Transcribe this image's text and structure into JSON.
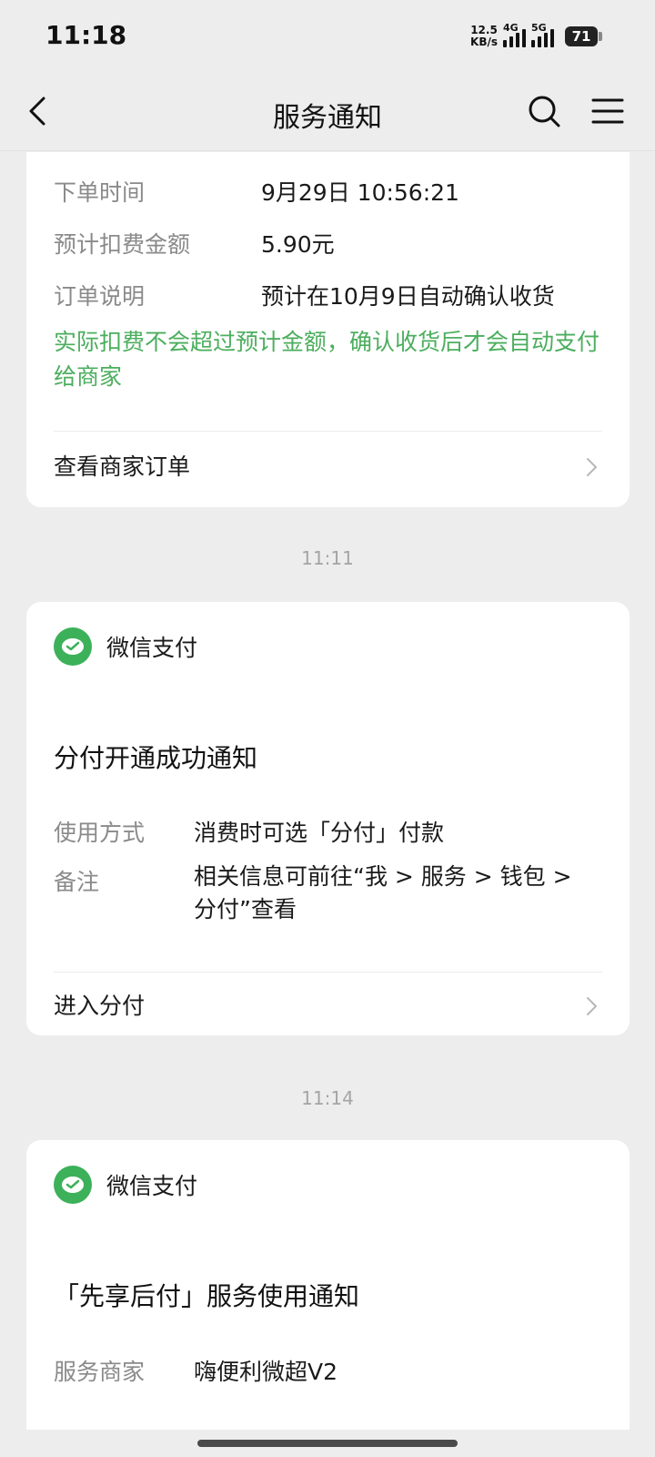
{
  "status_bar": {
    "time": "11:18",
    "net_speed_value": "12.5",
    "net_speed_unit": "KB/s",
    "signal1_tag": "4G",
    "signal2_tag": "5G",
    "battery": "71"
  },
  "nav": {
    "title": "服务通知"
  },
  "card1": {
    "rows": [
      {
        "label": "下单时间",
        "value": "9月29日 10:56:21"
      },
      {
        "label": "预计扣费金额",
        "value": "5.90元"
      },
      {
        "label": "订单说明",
        "value": "预计在10月9日自动确认收货"
      }
    ],
    "note": "实际扣费不会超过预计金额，确认收货后才会自动支付给商家",
    "link": "查看商家订单"
  },
  "timestamps": [
    "11:11",
    "11:14"
  ],
  "card2": {
    "brand": "微信支付",
    "title": "分付开通成功通知",
    "rows": [
      {
        "label": "使用方式",
        "value": "消费时可选「分付」付款"
      },
      {
        "label": "备注",
        "value": "相关信息可前往“我 > 服务 > 钱包 > 分付”查看"
      }
    ],
    "link": "进入分付"
  },
  "card3": {
    "brand": "微信支付",
    "title": "「先享后付」服务使用通知",
    "rows": [
      {
        "label": "服务商家",
        "value": "嗨便利微超V2"
      }
    ]
  },
  "colors": {
    "accent_green": "#4cae5e",
    "wechat_pay_green": "#3cb15a",
    "background": "#ededed"
  }
}
